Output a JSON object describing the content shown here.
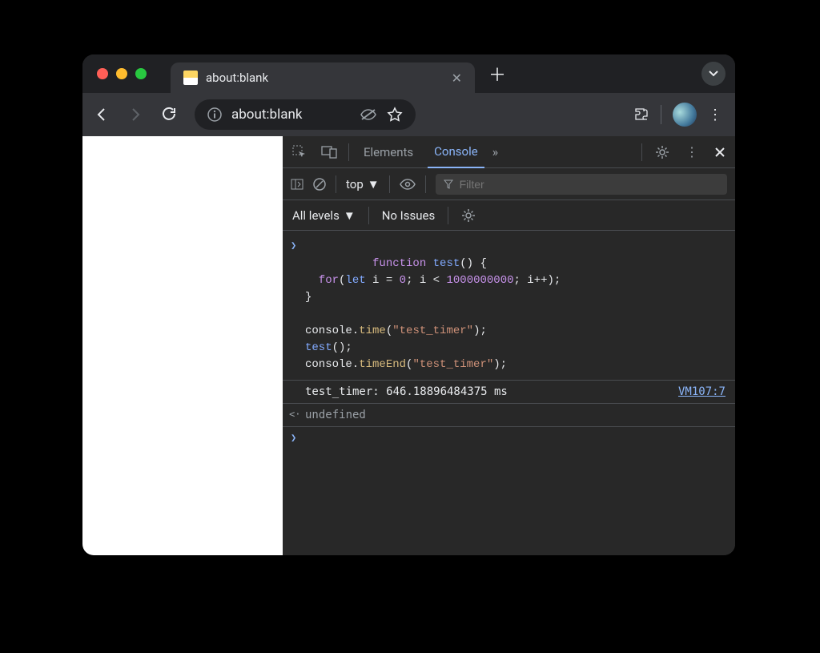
{
  "tab": {
    "title": "about:blank"
  },
  "omnibox": {
    "url": "about:blank"
  },
  "devtools": {
    "tabs": {
      "elements": "Elements",
      "console": "Console",
      "more": "»"
    },
    "console_toolbar": {
      "context": "top",
      "filter_placeholder": "Filter",
      "levels": "All levels",
      "issues": "No Issues"
    },
    "code": {
      "l1a": "function",
      "l1b": "test",
      "l1c": "() {",
      "l2a": "  for",
      "l2b": "(",
      "l2c": "let",
      "l2d": " i = ",
      "l2e": "0",
      "l2f": "; i < ",
      "l2g": "1000000000",
      "l2h": "; i++);",
      "l3": "}",
      "l5a": "console.",
      "l5b": "time",
      "l5c": "(",
      "l5d": "\"test_timer\"",
      "l5e": ");",
      "l6a": "test",
      "l6b": "();",
      "l7a": "console.",
      "l7b": "timeEnd",
      "l7c": "(",
      "l7d": "\"test_timer\"",
      "l7e": ");"
    },
    "log": {
      "text": "test_timer: 646.18896484375 ms",
      "source": "VM107:7"
    },
    "return_value": "undefined"
  }
}
